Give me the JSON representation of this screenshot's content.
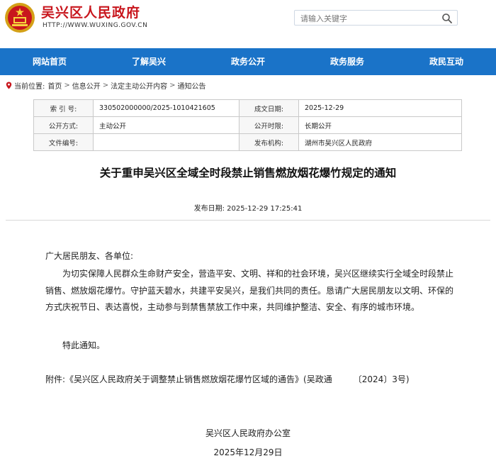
{
  "header": {
    "site_title": "吴兴区人民政府",
    "site_url": "HTTP://WWW.WUXING.GOV.CN",
    "search_placeholder": "请输入关键字",
    "brand_color": "#c8161d"
  },
  "nav": {
    "items": [
      "网站首页",
      "了解吴兴",
      "政务公开",
      "政务服务",
      "政民互动"
    ],
    "bg_color": "#1a73c8"
  },
  "breadcrumb": {
    "label": "当前位置:",
    "items": [
      "首页",
      "信息公开",
      "法定主动公开内容",
      "通知公告"
    ],
    "separator": ">"
  },
  "meta": {
    "index_label": "索 引 号:",
    "index_value": "330502000000/2025-1010421605",
    "date_label": "成文日期:",
    "date_value": "2025-12-29",
    "method_label": "公开方式:",
    "method_value": "主动公开",
    "period_label": "公开时限:",
    "period_value": "长期公开",
    "docno_label": "文件编号:",
    "docno_value": "",
    "org_label": "发布机构:",
    "org_value": "湖州市吴兴区人民政府"
  },
  "article": {
    "title": "关于重申吴兴区全域全时段禁止销售燃放烟花爆竹规定的通知",
    "pub_date_label": "发布日期:",
    "pub_date_value": "2025-12-29 17:25:41",
    "greeting": "广大居民朋友、各单位:",
    "paragraph": "为切实保障人民群众生命财产安全，营造平安、文明、祥和的社会环境，吴兴区继续实行全域全时段禁止销售、燃放烟花爆竹。守护蓝天碧水，共建平安吴兴，是我们共同的责任。恳请广大居民朋友以文明、环保的方式庆祝节日、表达喜悦，主动参与到禁售禁放工作中来，共同维护整洁、安全、有序的城市环境。",
    "closing": "特此通知。",
    "attachment": "附件:《吴兴区人民政府关于调整禁止销售燃放烟花爆竹区域的通告》(吴政通　　　〔2024〕3号)",
    "sign_org": "吴兴区人民政府办公室",
    "sign_date": "2025年12月29日"
  }
}
